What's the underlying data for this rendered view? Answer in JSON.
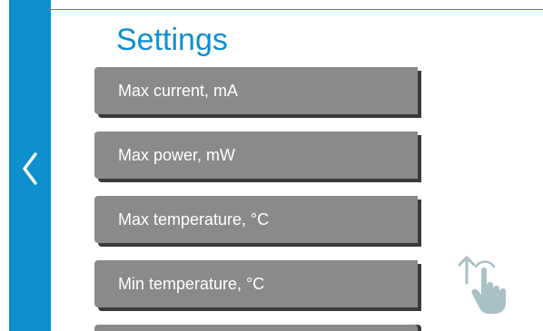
{
  "header": {
    "title": "Settings"
  },
  "menu": {
    "items": [
      {
        "label": "Max current, mA"
      },
      {
        "label": "Max power, mW"
      },
      {
        "label": "Max temperature, °C"
      },
      {
        "label": "Min temperature, °C"
      }
    ]
  },
  "icons": {
    "back": "chevron-left-icon",
    "scroll_hint": "swipe-up-hand-icon"
  },
  "colors": {
    "accent": "#0d8fd0",
    "button": "#8a8a8a",
    "button_shadow": "#3a3a3a",
    "hint_icon": "#a9c1c6"
  }
}
